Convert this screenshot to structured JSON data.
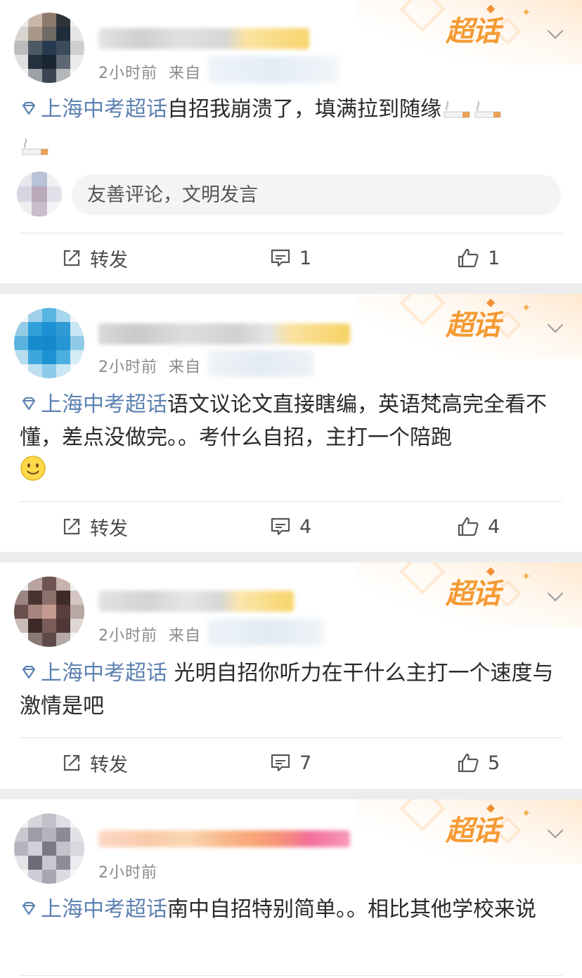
{
  "badge_text": "超话",
  "posts": [
    {
      "time": "2小时前",
      "from_label": "来自",
      "topic": "上海中考超话",
      "text": "自招我崩溃了，填满拉到随缘",
      "emojis": [
        "cigarette",
        "cigarette",
        "cigarette"
      ],
      "comment_placeholder": "友善评论，文明发言",
      "repost_label": "转发",
      "comments": "1",
      "likes": "1"
    },
    {
      "time": "2小时前",
      "from_label": "来自",
      "topic": "上海中考超话",
      "text": "语文议论文直接瞎编，英语梵高完全看不懂，差点没做完。。考什么自招，主打一个陪跑",
      "emojis": [
        "smile"
      ],
      "repost_label": "转发",
      "comments": "4",
      "likes": "4"
    },
    {
      "time": "2小时前",
      "from_label": "来自",
      "topic": "上海中考超话",
      "text": " 光明自招你听力在干什么主打一个速度与激情是吧",
      "repost_label": "转发",
      "comments": "7",
      "likes": "5"
    },
    {
      "time": "2小时前",
      "topic": "上海中考超话",
      "text": "南中自招特别简单。。相比其他学校来说"
    }
  ],
  "colors": {
    "topic": "#5d81b1",
    "badge": "#f59a33",
    "meta": "#8a8a8a"
  }
}
